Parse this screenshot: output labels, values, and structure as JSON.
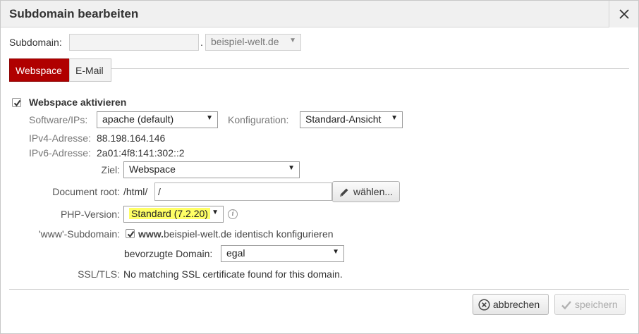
{
  "dialog": {
    "title": "Subdomain bearbeiten"
  },
  "subdomain": {
    "label": "Subdomain:",
    "value": "",
    "separator": ".",
    "domain_selected": "beispiel-welt.de"
  },
  "tabs": [
    {
      "label": "Webspace",
      "active": true
    },
    {
      "label": "E-Mail",
      "active": false
    }
  ],
  "webspace": {
    "activate_label": "Webspace aktivieren",
    "activate_checked": true,
    "software_label": "Software/IPs:",
    "software_selected": "apache (default)",
    "konfiguration_label": "Konfiguration:",
    "konfiguration_selected": "Standard-Ansicht",
    "ipv4_label": "IPv4-Adresse:",
    "ipv4_value": "88.198.164.146",
    "ipv6_label": "IPv6-Adresse:",
    "ipv6_value": "2a01:4f8:141:302::2",
    "ziel_label": "Ziel:",
    "ziel_selected": "Webspace",
    "docroot_label": "Document root:",
    "docroot_prefix": "/html/",
    "docroot_value": "/",
    "choose_button": "wählen...",
    "php_label": "PHP-Version:",
    "php_selected": "Standard (7.2.20)",
    "php_highlight_color": "#ffff66",
    "www_label": "'www'-Subdomain:",
    "www_checked": true,
    "www_bold": "www.",
    "www_text": "beispiel-welt.de identisch konfigurieren",
    "preferred_label": "bevorzugte Domain:",
    "preferred_selected": "egal",
    "ssl_label": "SSL/TLS:",
    "ssl_value": "No matching SSL certificate found for this domain."
  },
  "footer": {
    "cancel_label": "abbrechen",
    "save_label": "speichern"
  },
  "colors": {
    "accent": "#b00000",
    "titlebar": "#f0f0f0"
  },
  "icons": {
    "close": "close-icon",
    "pencil": "pencil-icon",
    "info": "info-icon",
    "cancel": "x-circle-icon",
    "save": "checkmark-icon"
  }
}
